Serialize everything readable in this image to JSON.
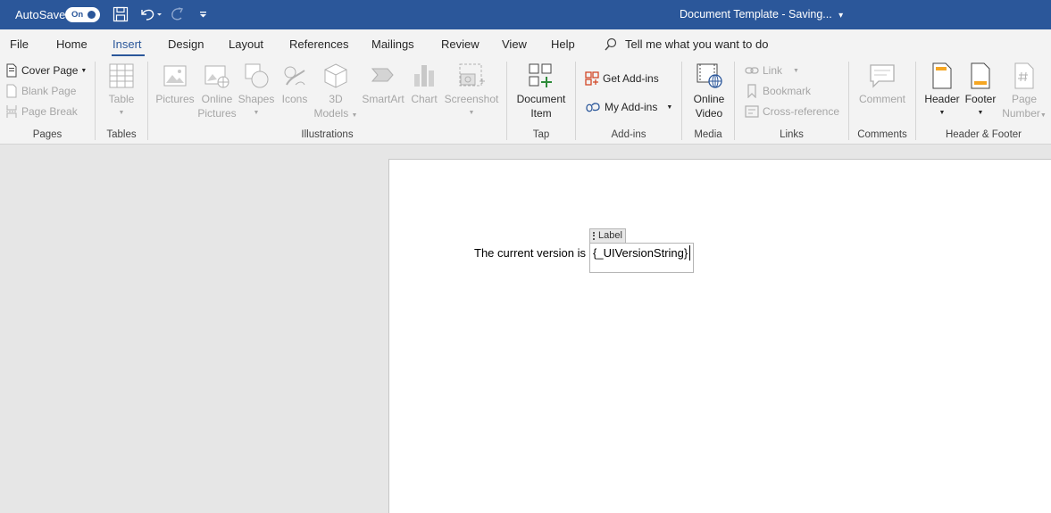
{
  "titlebar": {
    "autosave_label": "AutoSave",
    "toggle_state": "On",
    "document_title": "Document Template  -  Saving...",
    "title_caret": "▾"
  },
  "menu": {
    "tabs": [
      "File",
      "Home",
      "Insert",
      "Design",
      "Layout",
      "References",
      "Mailings",
      "Review",
      "View",
      "Help"
    ],
    "active_tab": "Insert",
    "tell_me_placeholder": "Tell me what you want to do"
  },
  "ribbon": {
    "pages": {
      "group_label": "Pages",
      "cover_page": "Cover Page",
      "blank_page": "Blank Page",
      "page_break": "Page Break"
    },
    "tables": {
      "group_label": "Tables",
      "table": "Table"
    },
    "illustrations": {
      "group_label": "Illustrations",
      "pictures": "Pictures",
      "online_pictures_1": "Online",
      "online_pictures_2": "Pictures",
      "shapes": "Shapes",
      "icons": "Icons",
      "models_1": "3D",
      "models_2": "Models",
      "smartart": "SmartArt",
      "chart": "Chart",
      "screenshot": "Screenshot"
    },
    "tap": {
      "group_label": "Tap",
      "document_item_1": "Document",
      "document_item_2": "Item"
    },
    "addins": {
      "group_label": "Add-ins",
      "get_addins": "Get Add-ins",
      "my_addins": "My Add-ins"
    },
    "media": {
      "group_label": "Media",
      "online_video_1": "Online",
      "online_video_2": "Video"
    },
    "links": {
      "group_label": "Links",
      "link": "Link",
      "bookmark": "Bookmark",
      "cross_reference": "Cross-reference"
    },
    "comments": {
      "group_label": "Comments",
      "comment": "Comment"
    },
    "header_footer": {
      "group_label": "Header & Footer",
      "header": "Header",
      "footer": "Footer",
      "page_number_1": "Page",
      "page_number_2": "Number"
    }
  },
  "document": {
    "body_text": "The current version is",
    "content_control_tag": "Label",
    "content_control_value": "{_UIVersionString}"
  },
  "colors": {
    "accent": "#2b579a",
    "ribbon_bg": "#f3f3f3",
    "canvas_bg": "#e6e6e6",
    "disabled_text": "#a6a6a6"
  }
}
